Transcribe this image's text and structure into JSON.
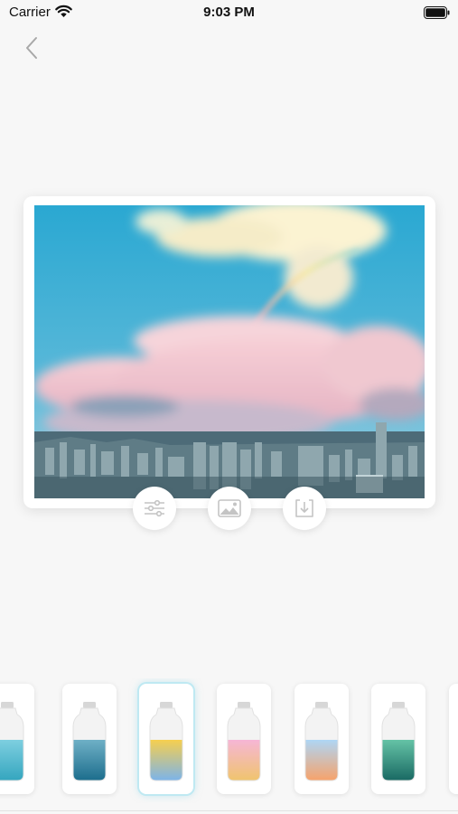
{
  "status_bar": {
    "carrier": "Carrier",
    "time": "9:03 PM",
    "wifi_icon": "wifi-icon",
    "battery_icon": "battery-icon"
  },
  "nav": {
    "back_icon": "chevron-left-icon"
  },
  "photo": {
    "subject": "city-skyline-with-rainbow"
  },
  "actions": [
    {
      "name": "adjust",
      "icon": "sliders-icon"
    },
    {
      "name": "photo",
      "icon": "image-icon"
    },
    {
      "name": "save",
      "icon": "download-icon"
    }
  ],
  "filters": {
    "selected_index": 2,
    "items": [
      {
        "top": "#7ecfe0",
        "bottom": "#35a6bf"
      },
      {
        "top": "#6fb0c6",
        "bottom": "#1d6e8d"
      },
      {
        "top": "#f6cf4f",
        "bottom": "#7db4e8"
      },
      {
        "top": "#f6b6d6",
        "bottom": "#f0c46e"
      },
      {
        "top": "#aed6f5",
        "bottom": "#f6a36c"
      },
      {
        "top": "#65c3a6",
        "bottom": "#1a6a64"
      }
    ]
  },
  "colors": {
    "background": "#f7f7f7",
    "accent": "#bfe9f2"
  }
}
